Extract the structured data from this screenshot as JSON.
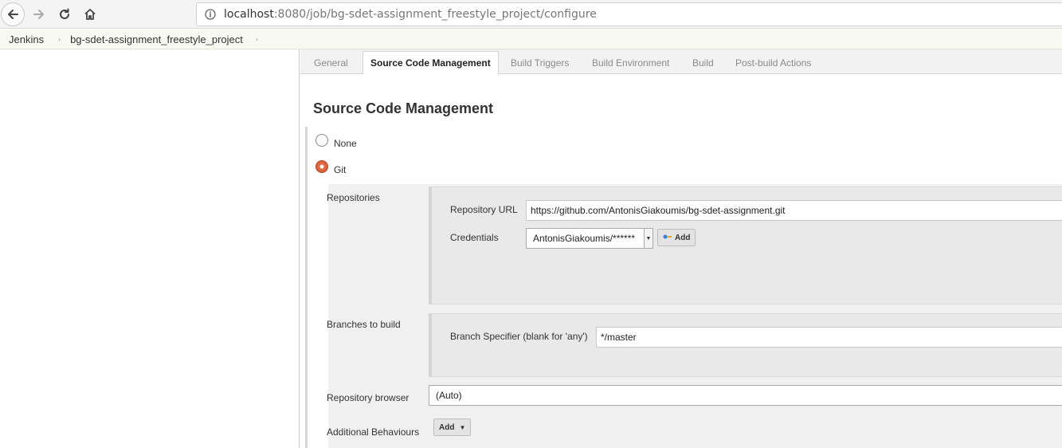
{
  "browser": {
    "url_host": "localhost",
    "url_path": ":8080/job/bg-sdet-assignment_freestyle_project/configure"
  },
  "breadcrumb": {
    "items": [
      "Jenkins",
      "bg-sdet-assignment_freestyle_project"
    ],
    "separator": "›"
  },
  "tabs": [
    {
      "label": "General"
    },
    {
      "label": "Source Code Management"
    },
    {
      "label": "Build Triggers"
    },
    {
      "label": "Build Environment"
    },
    {
      "label": "Build"
    },
    {
      "label": "Post-build Actions"
    }
  ],
  "active_tab": "Source Code Management",
  "scm": {
    "title": "Source Code Management",
    "options": [
      {
        "label": "None",
        "selected": false
      },
      {
        "label": "Git",
        "selected": true
      }
    ],
    "repositories_label": "Repositories",
    "repository_url_label": "Repository URL",
    "repository_url_value": "https://github.com/AntonisGiakoumis/bg-sdet-assignment.git",
    "credentials_label": "Credentials",
    "credentials_value": "AntonisGiakoumis/******",
    "credentials_add_label": "Add",
    "branches_label": "Branches to build",
    "branch_specifier_label": "Branch Specifier (blank for 'any')",
    "branch_specifier_value": "*/master",
    "repo_browser_label": "Repository browser",
    "repo_browser_value": "(Auto)",
    "additional_behaviours_label": "Additional Behaviours",
    "additional_behaviours_add_label": "Add"
  },
  "colors": {
    "radio_selected": "#e0663f",
    "tab_bar": "#f2f2f2",
    "panel": "#e9e9e9"
  }
}
